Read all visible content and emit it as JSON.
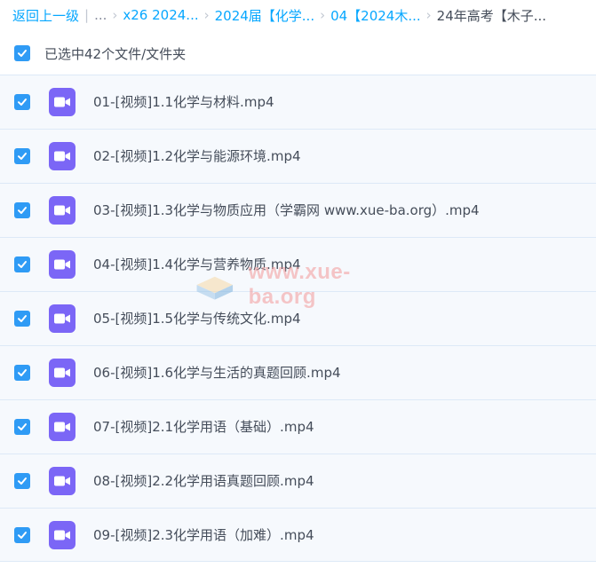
{
  "breadcrumb": {
    "back": "返回上一级",
    "sep": "|",
    "ellipsis": "...",
    "items": [
      "x26 2024...",
      "2024届【化学...",
      "04【2024木...",
      "24年高考【木子..."
    ]
  },
  "selection": {
    "label": "已选中42个文件/文件夹",
    "checked": true
  },
  "files": [
    {
      "name": "01-[视频]1.1化学与材料.mp4",
      "checked": true
    },
    {
      "name": "02-[视频]1.2化学与能源环境.mp4",
      "checked": true
    },
    {
      "name": "03-[视频]1.3化学与物质应用（学霸网 www.xue-ba.org）.mp4",
      "checked": true
    },
    {
      "name": "04-[视频]1.4化学与营养物质.mp4",
      "checked": true
    },
    {
      "name": "05-[视频]1.5化学与传统文化.mp4",
      "checked": true
    },
    {
      "name": "06-[视频]1.6化学与生活的真题回顾.mp4",
      "checked": true
    },
    {
      "name": "07-[视频]2.1化学用语（基础）.mp4",
      "checked": true
    },
    {
      "name": "08-[视频]2.2化学用语真题回顾.mp4",
      "checked": true
    },
    {
      "name": "09-[视频]2.3化学用语（加难）.mp4",
      "checked": true
    }
  ],
  "watermark": {
    "text": "www.xue-ba.org"
  },
  "colors": {
    "accent": "#06a7ff",
    "checkbox": "#2f9bf5",
    "video_icon": "#7b66f6",
    "row_bg": "#f6f9fd"
  },
  "icons": {
    "checkbox": "checkmark-icon",
    "file": "video-file-icon"
  }
}
